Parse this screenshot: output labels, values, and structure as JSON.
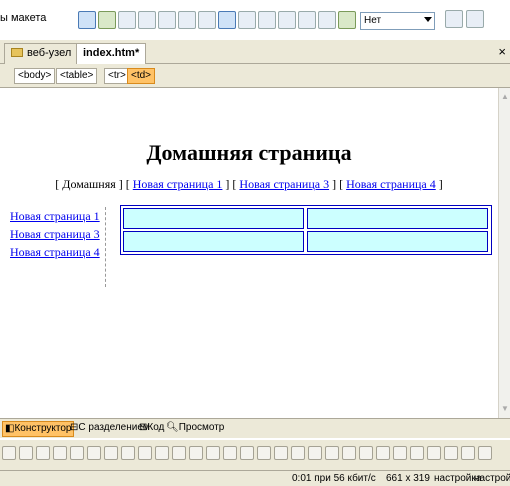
{
  "toolbar": {
    "layout_label": "ы макета",
    "select_value": "Нет"
  },
  "tabs": [
    {
      "label": "веб-узел"
    },
    {
      "label": "index.htm*"
    }
  ],
  "tagbar": {
    "tags": [
      "<body>",
      "<table>",
      "<tr>",
      "<td>"
    ]
  },
  "page": {
    "title": "Домашняя страница",
    "nav": {
      "bracket_open": "[",
      "home": "Домашняя",
      "sep": "] [",
      "links": [
        "Новая страница 1",
        "Новая страница 3",
        "Новая страница 4"
      ],
      "bracket_close": "]"
    },
    "sidenav": [
      "Новая страница 1",
      "Новая страница 3",
      "Новая страница 4"
    ]
  },
  "view_tabs": [
    {
      "label": "Конструктор"
    },
    {
      "label": "С разделением"
    },
    {
      "label": "Код"
    },
    {
      "label": "Просмотр"
    }
  ],
  "status": {
    "speed": "0:01 при 56 кбит/с",
    "size": "661 x 319",
    "setting1": "настройка",
    "setting2": "настройка"
  },
  "colors": {
    "cell_fill": "#ccffff",
    "cell_border": "#0000c0",
    "active_tag": "#ffc266",
    "link": "#0000ee"
  }
}
